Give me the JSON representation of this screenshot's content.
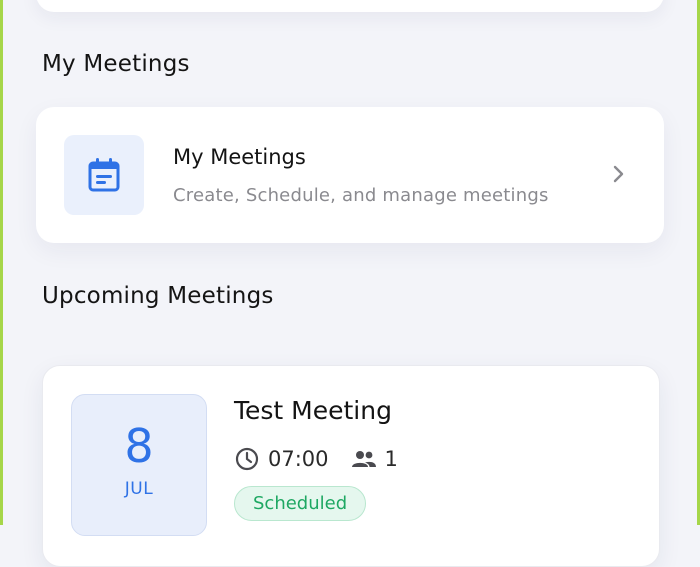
{
  "sections": {
    "my_meetings_title": "My Meetings",
    "upcoming_title": "Upcoming Meetings"
  },
  "menu_card": {
    "title": "My Meetings",
    "subtitle": "Create, Schedule, and manage meetings",
    "icon": "calendar-icon"
  },
  "upcoming": [
    {
      "day": "8",
      "month": "JUL",
      "title": "Test Meeting",
      "time": "07:00",
      "participants": "1",
      "status": "Scheduled"
    }
  ],
  "colors": {
    "accent_blue": "#2f72e6",
    "status_green": "#1fa863",
    "background": "#f3f4f9",
    "edge_green": "#a6d64a"
  }
}
